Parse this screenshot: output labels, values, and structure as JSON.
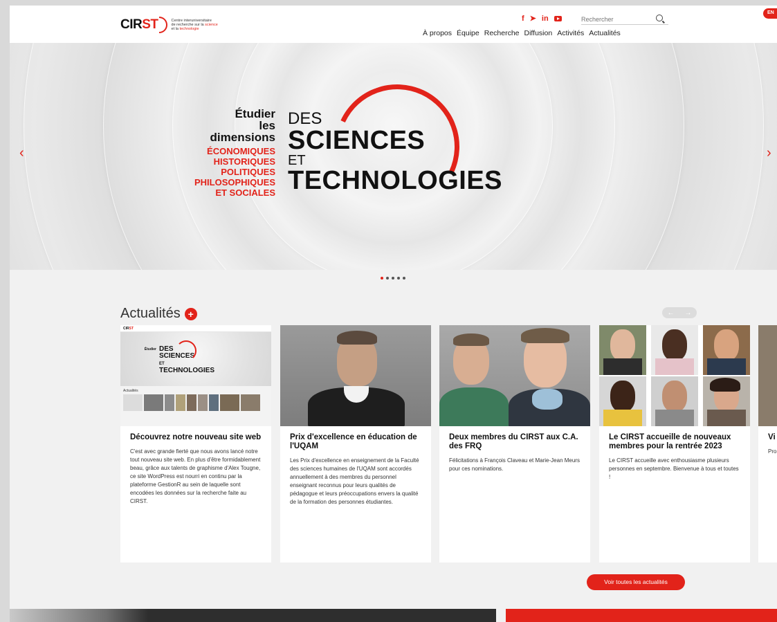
{
  "header": {
    "logo": {
      "cir": "CIR",
      "st": "ST",
      "tag1": "Centre interuniversitaire",
      "tag2": "de recherche sur la",
      "tag2b": "science",
      "tag3": "et la",
      "tag3b": "technologie"
    },
    "social": [
      "f",
      "➤",
      "in"
    ],
    "search_placeholder": "Rechercher",
    "lang": "EN",
    "nav": [
      "À propos",
      "Équipe",
      "Recherche",
      "Diffusion",
      "Activités",
      "Actualités"
    ]
  },
  "hero": {
    "left_line1": "Étudier",
    "left_line2": "les dimensions",
    "red_lines": [
      "ÉCONOMIQUES",
      "HISTORIQUES",
      "POLITIQUES",
      "PHILOSOPHIQUES",
      "ET SOCIALES"
    ],
    "des": "DES",
    "sciences": "SCIENCES",
    "et": "ET",
    "technologies": "TECHNOLOGIES",
    "prev": "‹",
    "next": "›",
    "slide_count": 5,
    "active_slide": 1
  },
  "news": {
    "title": "Actualités",
    "see_all": "Voir toutes les actualités",
    "cards": [
      {
        "title": "Découvrez notre nouveau site web",
        "text": "C'est avec grande fierté que nous avons lancé notre tout nouveau site web. En plus d'être formidablement beau, grâce aux talents de graphisme d'Alex Tougne, ce site WordPress est nourri en continu par la plateforme GestionR au sein de laquelle sont encodées les données sur la recherche faite au CIRST."
      },
      {
        "title": "Prix d'excellence en éducation de l'UQAM",
        "text": "Les Prix d'excellence en enseignement de la Faculté des sciences humaines de l'UQAM sont accordés annuellement à des membres du personnel enseignant reconnus pour leurs qualités de pédagogue et leurs préoccupations envers la qualité de la formation des personnes étudiantes."
      },
      {
        "title": "Deux membres du CIRST aux C.A. des FRQ",
        "text": "Félicitations à François Claveau et Marie-Jean Meurs pour ces nominations."
      },
      {
        "title": "Le CIRST accueille de nouveaux membres pour la rentrée 2023",
        "text": "Le CIRST accueille avec enthousiasme plusieurs personnes en septembre. Bienvenue à tous et toutes !"
      },
      {
        "title": "Vi pr sc",
        "text": "Pro et l'Ur jus rec tra sa co l'Ur"
      }
    ]
  }
}
